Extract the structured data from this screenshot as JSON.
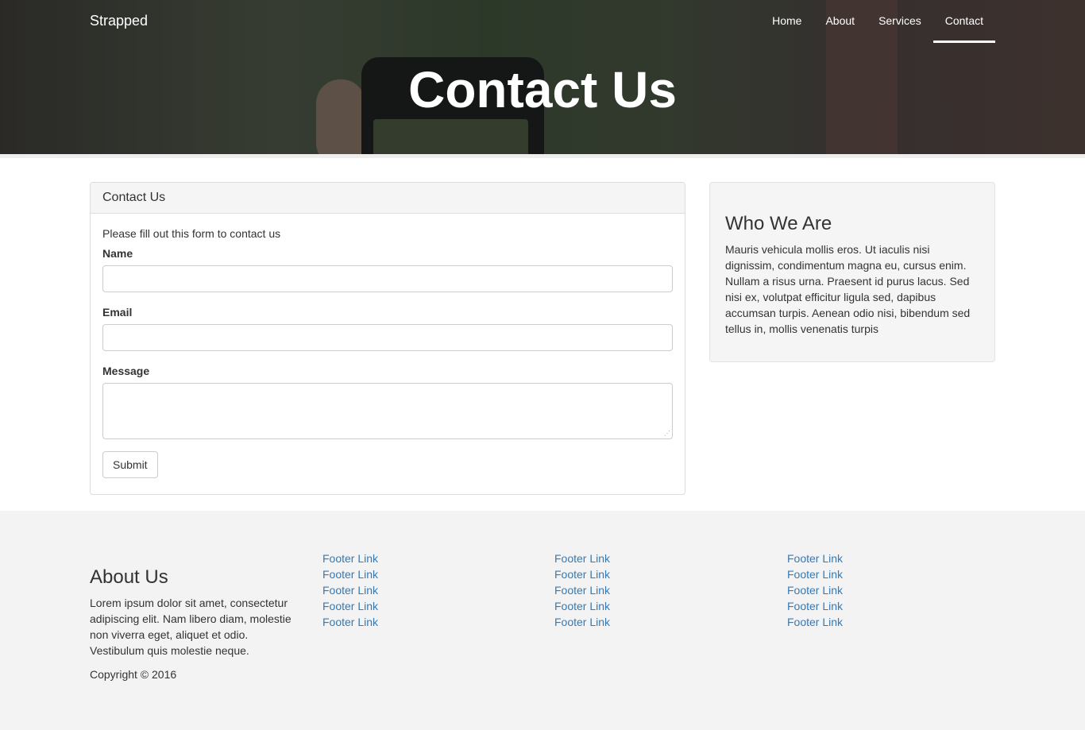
{
  "brand": "Strapped",
  "nav": [
    "Home",
    "About",
    "Services",
    "Contact"
  ],
  "nav_active": "Contact",
  "hero_title": "Contact Us",
  "contact_panel": {
    "heading": "Contact Us",
    "intro": "Please fill out this form to contact us",
    "name_label": "Name",
    "email_label": "Email",
    "message_label": "Message",
    "name_value": "",
    "email_value": "",
    "message_value": "",
    "submit_label": "Submit"
  },
  "sidebar": {
    "title": "Who We Are",
    "body": "Mauris vehicula mollis eros. Ut iaculis nisi dignissim, condimentum magna eu, cursus enim. Nullam a risus urna. Praesent id purus lacus. Sed nisi ex, volutpat efficitur ligula sed, dapibus accumsan turpis. Aenean odio nisi, bibendum sed tellus in, mollis venenatis turpis"
  },
  "footer": {
    "about_title": "About Us",
    "about_text": "Lorem ipsum dolor sit amet, consectetur adipiscing elit. Nam libero diam, molestie non viverra eget, aliquet et odio. Vestibulum quis molestie neque.",
    "copyright": "Copyright © 2016",
    "link_columns": [
      [
        "Footer Link",
        "Footer Link",
        "Footer Link",
        "Footer Link",
        "Footer Link"
      ],
      [
        "Footer Link",
        "Footer Link",
        "Footer Link",
        "Footer Link",
        "Footer Link"
      ],
      [
        "Footer Link",
        "Footer Link",
        "Footer Link",
        "Footer Link",
        "Footer Link"
      ]
    ]
  },
  "colors": {
    "link": "#337ab7",
    "footer_bg": "#f3f3f3",
    "panel_heading_bg": "#f5f5f5"
  }
}
